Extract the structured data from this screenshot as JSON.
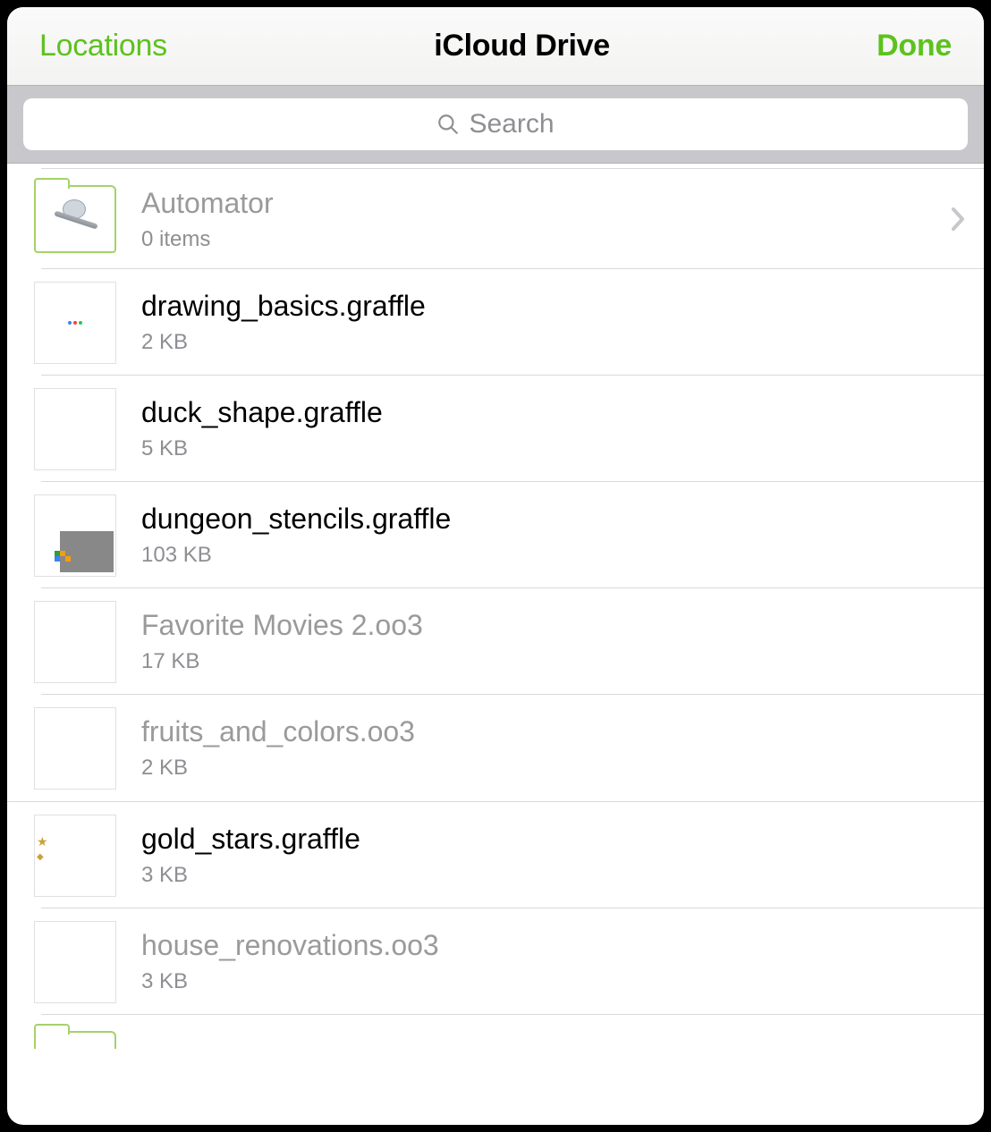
{
  "nav": {
    "back_label": "Locations",
    "title": "iCloud Drive",
    "done_label": "Done"
  },
  "search": {
    "placeholder": "Search"
  },
  "rows": [
    {
      "name": "Automator",
      "sub": "0 items",
      "is_folder": true,
      "disabled": true,
      "thumb": "automator"
    },
    {
      "name": "drawing_basics.graffle",
      "sub": "2 KB",
      "is_folder": false,
      "disabled": false,
      "thumb": "dots"
    },
    {
      "name": "duck_shape.graffle",
      "sub": "5 KB",
      "is_folder": false,
      "disabled": false,
      "thumb": "blank"
    },
    {
      "name": "dungeon_stencils.graffle",
      "sub": "103 KB",
      "is_folder": false,
      "disabled": false,
      "thumb": "dungeon"
    },
    {
      "name": "Favorite Movies 2.oo3",
      "sub": "17 KB",
      "is_folder": false,
      "disabled": true,
      "thumb": "blank"
    },
    {
      "name": "fruits_and_colors.oo3",
      "sub": "2 KB",
      "is_folder": false,
      "disabled": true,
      "thumb": "blank"
    },
    {
      "name": "gold_stars.graffle",
      "sub": "3 KB",
      "is_folder": false,
      "disabled": false,
      "thumb": "stars"
    },
    {
      "name": "house_renovations.oo3",
      "sub": "3 KB",
      "is_folder": false,
      "disabled": true,
      "thumb": "blank"
    }
  ]
}
